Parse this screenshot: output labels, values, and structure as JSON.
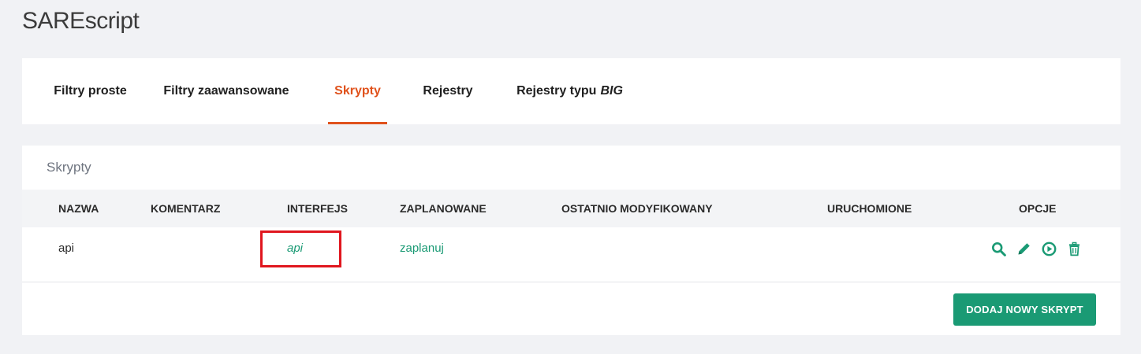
{
  "app": {
    "title": "SAREscript"
  },
  "tabs": [
    {
      "label": "Filtry proste",
      "active": false
    },
    {
      "label": "Filtry zaawansowane",
      "active": false
    },
    {
      "label": "Skrypty",
      "active": true
    },
    {
      "label": "Rejestry",
      "active": false
    },
    {
      "label": "Rejestry typu",
      "suffix": "BIG",
      "active": false
    }
  ],
  "scripts_panel": {
    "title": "Skrypty",
    "columns": [
      "NAZWA",
      "KOMENTARZ",
      "INTERFEJS",
      "ZAPLANOWANE",
      "OSTATNIO MODYFIKOWANY",
      "URUCHOMIONE",
      "OPCJE"
    ],
    "rows": [
      {
        "nazwa": "api",
        "komentarz": "",
        "interfejs": "api",
        "zaplanowane": "zaplanuj",
        "ostatnio_modyfikowany": "",
        "uruchomione": "",
        "options": [
          "search-icon",
          "pencil-icon",
          "play-circle-icon",
          "trash-icon"
        ]
      }
    ],
    "add_button_label": "DODAJ NOWY SKRYPT"
  },
  "colors": {
    "accent_active_tab": "#e0521c",
    "link_green": "#1a9a74",
    "highlight_red": "#e0161e"
  }
}
